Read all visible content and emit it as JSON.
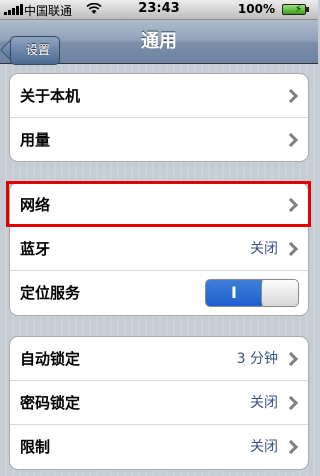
{
  "status_bar": {
    "carrier": "中国联通",
    "time": "23:43",
    "battery": "100%"
  },
  "nav": {
    "back": "设置",
    "title": "通用"
  },
  "groups": [
    {
      "rows": [
        {
          "label": "关于本机",
          "value": ""
        },
        {
          "label": "用量",
          "value": ""
        }
      ]
    },
    {
      "rows": [
        {
          "label": "网络",
          "value": ""
        },
        {
          "label": "蓝牙",
          "value": "关闭"
        },
        {
          "label": "定位服务",
          "toggle": "I"
        }
      ]
    },
    {
      "rows": [
        {
          "label": "自动锁定",
          "value": "3 分钟"
        },
        {
          "label": "密码锁定",
          "value": "关闭"
        },
        {
          "label": "限制",
          "value": "关闭"
        }
      ]
    }
  ],
  "colors": {
    "highlight": "#e40000",
    "value_text": "#385487",
    "toggle_on": "#1d5fd0"
  }
}
